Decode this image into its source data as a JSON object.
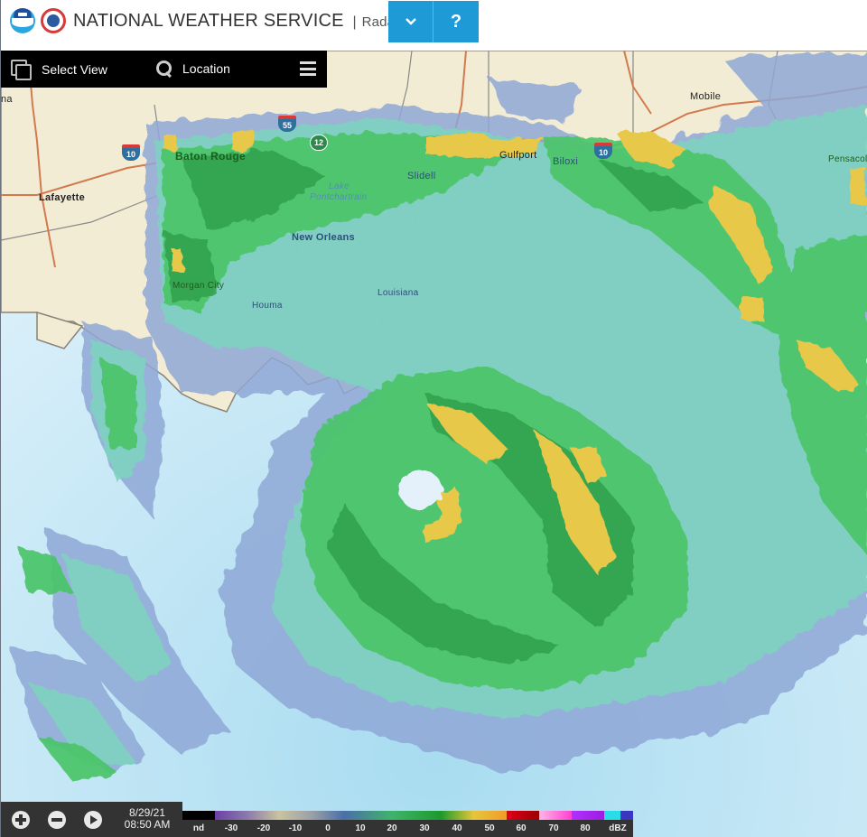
{
  "header": {
    "logos": [
      "noaa-logo",
      "nws-logo"
    ],
    "title": "NATIONAL WEATHER SERVICE",
    "separator": "|",
    "subtitle": "Radar",
    "dropdown_icon": "chevron-down-icon",
    "dropdown_glyph": "⌄",
    "help_label": "?",
    "accent_color": "#1e9ad6"
  },
  "toolbar": {
    "select_view_label": "Select View",
    "select_view_icon": "copy-icon",
    "location_label": "Location",
    "location_icon": "search-icon",
    "menu_icon": "hamburger-menu-icon"
  },
  "map": {
    "cities": [
      {
        "name": "Baton Rouge",
        "style": "green"
      },
      {
        "name": "Lafayette",
        "style": "dark"
      },
      {
        "name": "New Orleans",
        "style": "blue"
      },
      {
        "name": "Morgan City",
        "style": "green"
      },
      {
        "name": "Houma",
        "style": "blue"
      },
      {
        "name": "Slidell",
        "style": "blue"
      },
      {
        "name": "Gulfport",
        "style": "dark"
      },
      {
        "name": "Biloxi",
        "style": "blue"
      },
      {
        "name": "Mobile",
        "style": "dark"
      },
      {
        "name": "Pensacola",
        "style": "green"
      },
      {
        "name": "Louisiana",
        "style": "blue"
      },
      {
        "name": "Lake Pontchartrain",
        "style": "water"
      },
      {
        "name": "na",
        "style": "dark"
      }
    ],
    "highway_shields": [
      {
        "type": "interstate",
        "number": "10"
      },
      {
        "type": "interstate",
        "number": "55"
      },
      {
        "type": "us",
        "number": "12"
      },
      {
        "type": "interstate",
        "number": "10"
      }
    ],
    "water_label_line1": "Lake",
    "water_label_line2": "Pontchartrain"
  },
  "controls": {
    "zoom_in_icon": "plus-circle-icon",
    "zoom_out_icon": "minus-circle-icon",
    "play_icon": "play-circle-icon",
    "date": "8/29/21",
    "time": "08:50 AM"
  },
  "legend": {
    "unit": "dBZ",
    "labels": [
      "nd",
      "-30",
      "-20",
      "-10",
      "0",
      "10",
      "20",
      "30",
      "40",
      "50",
      "60",
      "70",
      "80",
      "dBZ"
    ],
    "colors": [
      "#000000",
      "#6c3fa6",
      "#8a7bab",
      "#c9c3a0",
      "#9aa0a8",
      "#4a6fa8",
      "#3fb36b",
      "#1c9a2c",
      "#e6c63a",
      "#f39a2b",
      "#e00018",
      "#9a0000",
      "#ffb6e6",
      "#d040ff",
      "#9d1ce0",
      "#2adbe8",
      "#3a36c0"
    ]
  }
}
